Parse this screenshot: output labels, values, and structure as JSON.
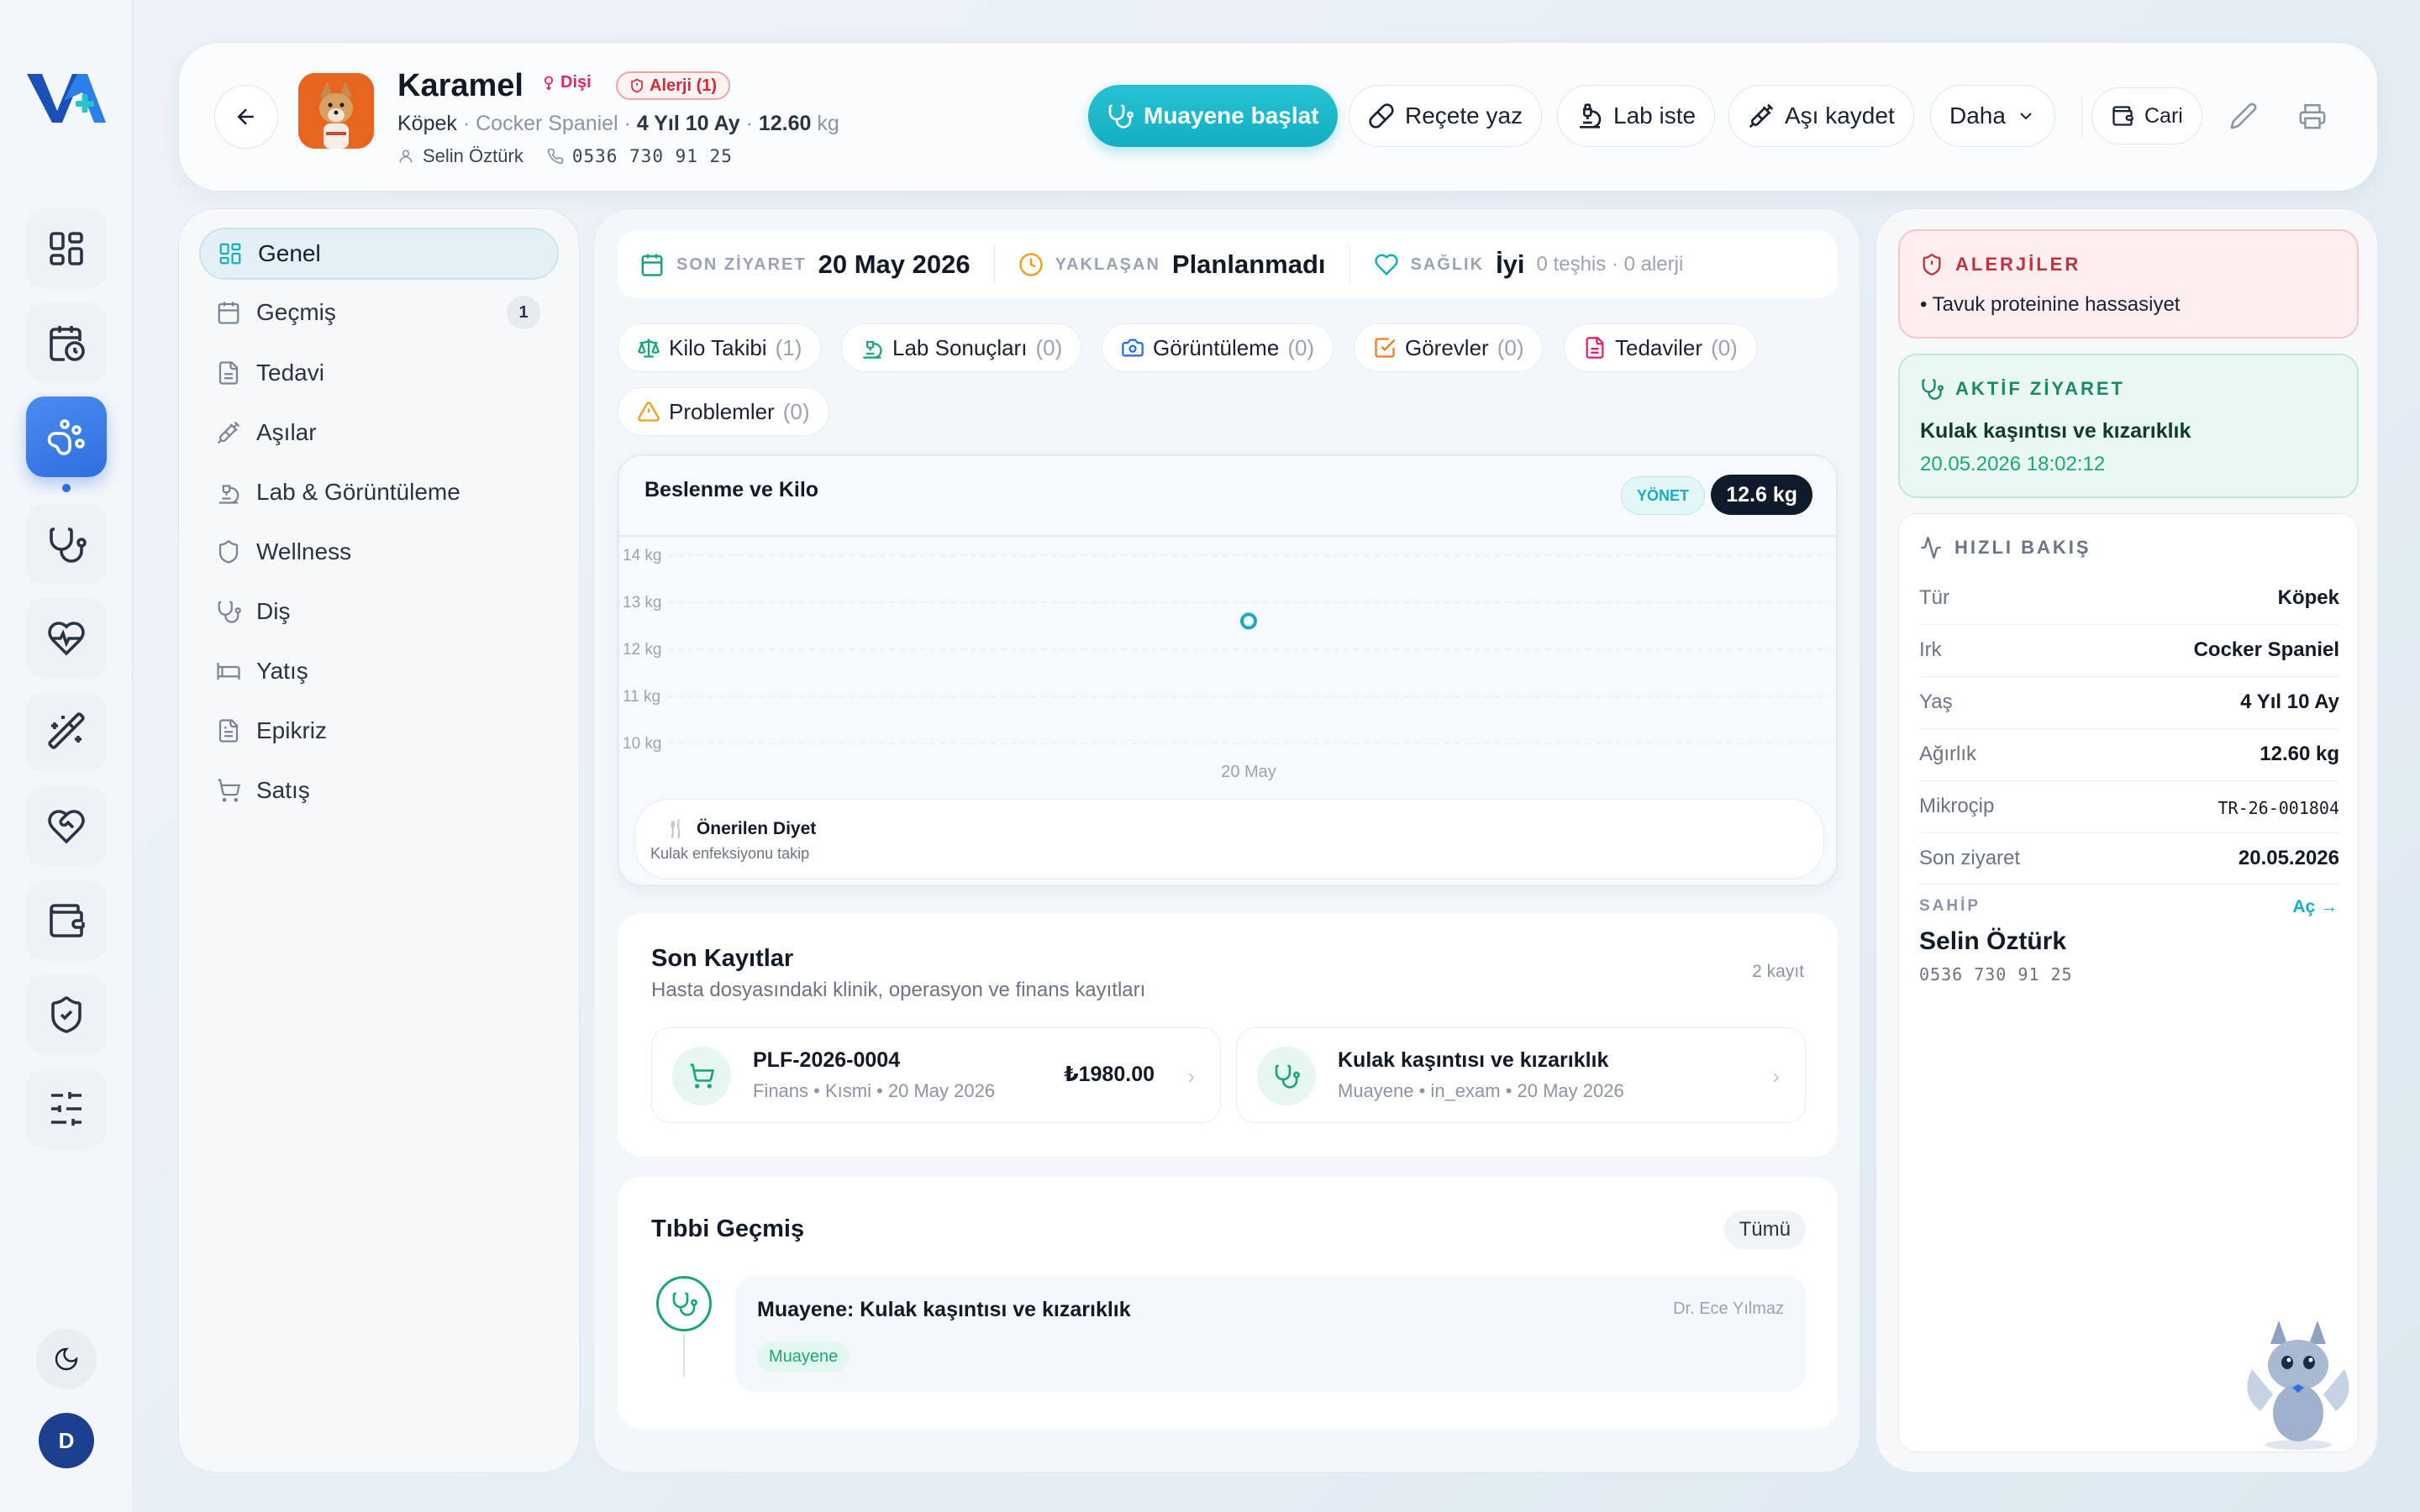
{
  "colors": {
    "accent": "#14aec2",
    "brand": "#2f6fe0",
    "danger": "#d8263a",
    "success": "#1aa67a"
  },
  "rail": {
    "icons": [
      "dashboard-icon",
      "calendar-clock-icon",
      "paw-icon",
      "stethoscope-icon",
      "heart-pulse-icon",
      "wand-icon",
      "heart-hand-icon",
      "wallet-icon",
      "shield-check-icon",
      "sliders-icon"
    ],
    "avatar_initial": "D"
  },
  "header": {
    "pet_name": "Karamel",
    "sex": "Dişi",
    "allergy_badge": "Alerji (1)",
    "species": "Köpek",
    "breed": "Cocker Spaniel",
    "age": "4 Yıl 10 Ay",
    "weight": "12.60",
    "weight_unit": "kg",
    "owner": "Selin Öztürk",
    "phone": "0536 730 91 25",
    "buttons": {
      "start_exam": "Muayene başlat",
      "prescription": "Reçete yaz",
      "lab": "Lab iste",
      "vaccine": "Aşı kaydet",
      "more": "Daha",
      "account": "Cari"
    }
  },
  "nav": {
    "items": [
      {
        "label": "Genel"
      },
      {
        "label": "Geçmiş",
        "count": "1"
      },
      {
        "label": "Tedavi"
      },
      {
        "label": "Aşılar"
      },
      {
        "label": "Lab & Görüntüleme"
      },
      {
        "label": "Wellness"
      },
      {
        "label": "Diş"
      },
      {
        "label": "Yatış"
      },
      {
        "label": "Epikriz"
      },
      {
        "label": "Satış"
      }
    ]
  },
  "summary": {
    "last_visit_label": "SON ZİYARET",
    "last_visit_value": "20 May 2026",
    "upcoming_label": "YAKLAŞAN",
    "upcoming_value": "Planlanmadı",
    "health_label": "SAĞLIK",
    "health_value": "İyi",
    "health_sub": "0 teşhis · 0 alerji"
  },
  "chips": [
    {
      "label": "Kilo Takibi",
      "count": "(1)"
    },
    {
      "label": "Lab Sonuçları",
      "count": "(0)"
    },
    {
      "label": "Görüntüleme",
      "count": "(0)"
    },
    {
      "label": "Görevler",
      "count": "(0)"
    },
    {
      "label": "Tedaviler",
      "count": "(0)"
    },
    {
      "label": "Problemler",
      "count": "(0)"
    }
  ],
  "nutrition": {
    "title": "Beslenme ve Kilo",
    "manage": "YÖNET",
    "current_weight": "12.6 kg",
    "diet_title": "Önerilen Diyet",
    "diet_sub": "Kulak enfeksiyonu takip"
  },
  "chart_data": {
    "type": "scatter",
    "x": [
      "20 May"
    ],
    "values": [
      12.6
    ],
    "yticks": [
      "10 kg",
      "11 kg",
      "12 kg",
      "13 kg",
      "14 kg"
    ],
    "ylim": [
      10,
      14
    ],
    "xlabel": "",
    "ylabel": "",
    "grid": true
  },
  "recent": {
    "title": "Son Kayıtlar",
    "subtitle": "Hasta dosyasındaki klinik, operasyon ve finans kayıtları",
    "count": "2 kayıt",
    "items": [
      {
        "title": "PLF-2026-0004",
        "meta": "Finans • Kısmi • 20 May 2026",
        "amount": "₺1980.00",
        "icon": "cart-icon"
      },
      {
        "title": "Kulak kaşıntısı ve kızarıklık",
        "meta": "Muayene • in_exam • 20 May 2026",
        "amount": "",
        "icon": "stethoscope-icon"
      }
    ]
  },
  "history": {
    "title": "Tıbbi Geçmiş",
    "all": "Tümü",
    "entry_title": "Muayene: Kulak kaşıntısı ve kızarıklık",
    "doctor": "Dr. Ece Yılmaz",
    "tag": "Muayene"
  },
  "right": {
    "allergy_title": "ALERJİLER",
    "allergy_item": "• Tavuk proteinine hassasiyet",
    "visit_title": "AKTİF ZİYARET",
    "visit_text": "Kulak kaşıntısı ve kızarıklık",
    "visit_date": "20.05.2026 18:02:12",
    "quick_title": "HIZLI BAKIŞ",
    "rows": [
      {
        "k": "Tür",
        "v": "Köpek"
      },
      {
        "k": "Irk",
        "v": "Cocker Spaniel"
      },
      {
        "k": "Yaş",
        "v": "4 Yıl 10 Ay"
      },
      {
        "k": "Ağırlık",
        "v": "12.60 kg"
      },
      {
        "k": "Mikroçip",
        "v": "TR-26-001804"
      },
      {
        "k": "Son ziyaret",
        "v": "20.05.2026"
      }
    ],
    "owner_label": "SAHİP",
    "owner_open": "Aç →",
    "owner_name": "Selin Öztürk",
    "owner_phone": "0536 730 91 25"
  }
}
